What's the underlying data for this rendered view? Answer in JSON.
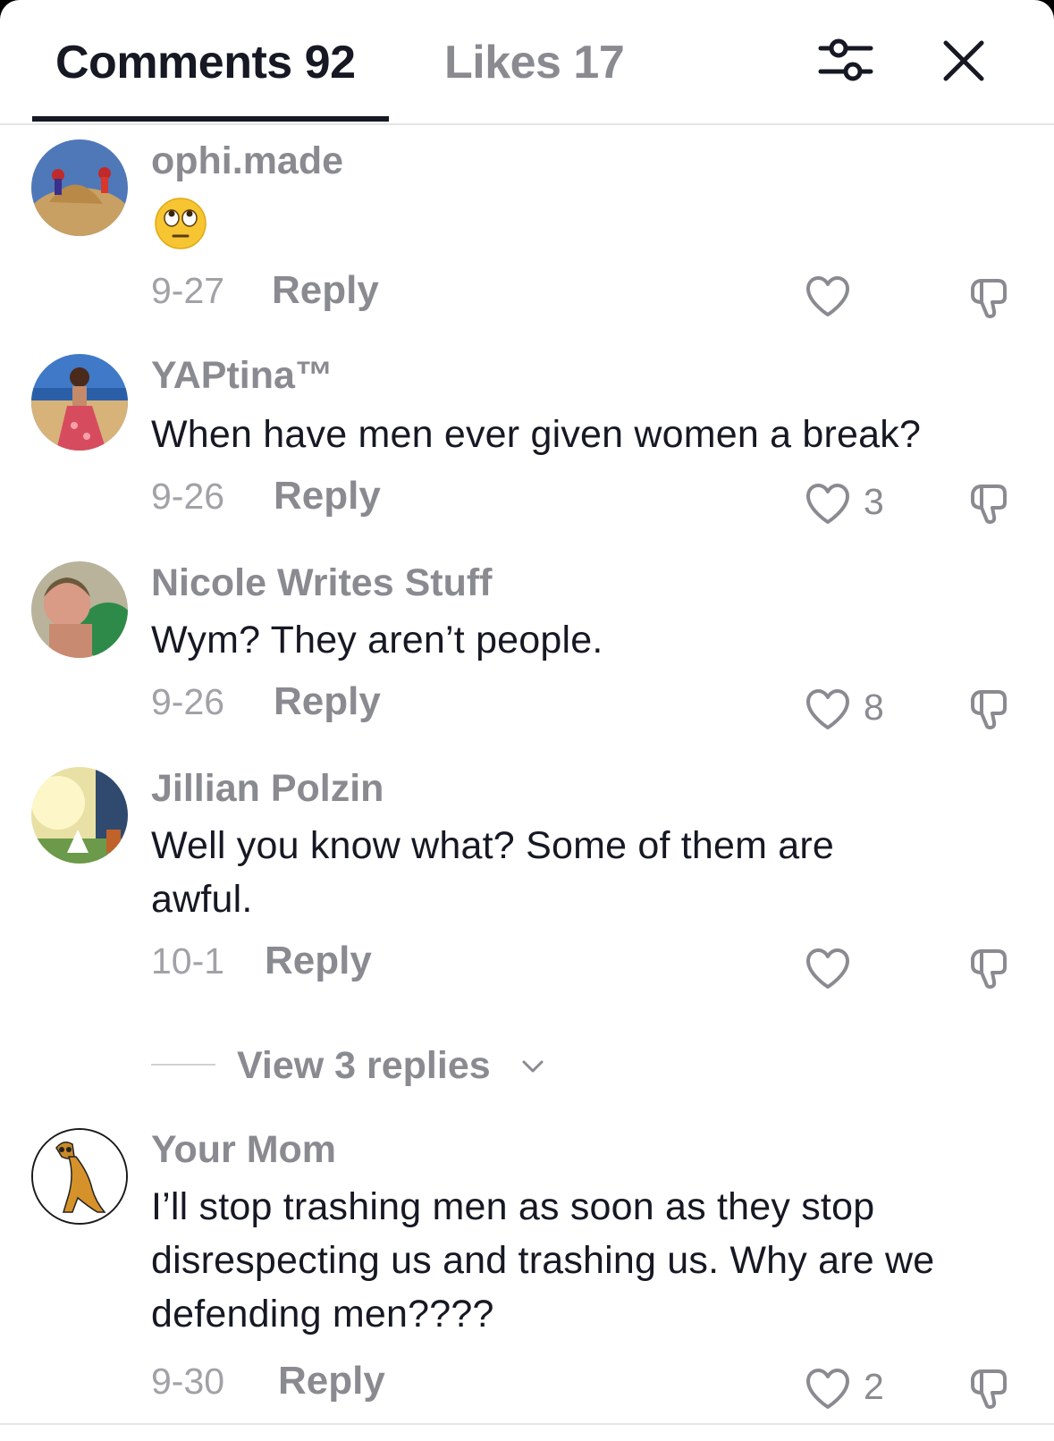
{
  "header": {
    "tab_comments": "Comments 92",
    "tab_likes": "Likes 17",
    "filter_icon": "sliders-icon",
    "close_icon": "close-icon"
  },
  "comments": [
    {
      "username": "ophi.made",
      "emoji": "face-with-rolling-eyes",
      "text": "",
      "date": "9-27",
      "reply": "Reply",
      "likes": ""
    },
    {
      "username": "YAPtina™",
      "text": "When have men ever given women a break?",
      "date": "9-26",
      "reply": "Reply",
      "likes": "3"
    },
    {
      "username": "Nicole Writes Stuff",
      "text": "Wym? They aren’t people.",
      "date": "9-26",
      "reply": "Reply",
      "likes": "8"
    },
    {
      "username": "Jillian Polzin",
      "text": "Well you know what? Some of them are awful.",
      "date": "10-1",
      "reply": "Reply",
      "likes": ""
    },
    {
      "username": "Your Mom",
      "text": "I’ll stop trashing men as soon as they stop disrespecting us and trashing us. Why are we defending men????",
      "date": "9-30",
      "reply": "Reply",
      "likes": "2"
    }
  ],
  "view_replies": {
    "label": "View 3 replies"
  },
  "colors": {
    "primary_text": "#161823",
    "secondary_text": "#8a8b91",
    "divider": "#e6e6e6"
  }
}
